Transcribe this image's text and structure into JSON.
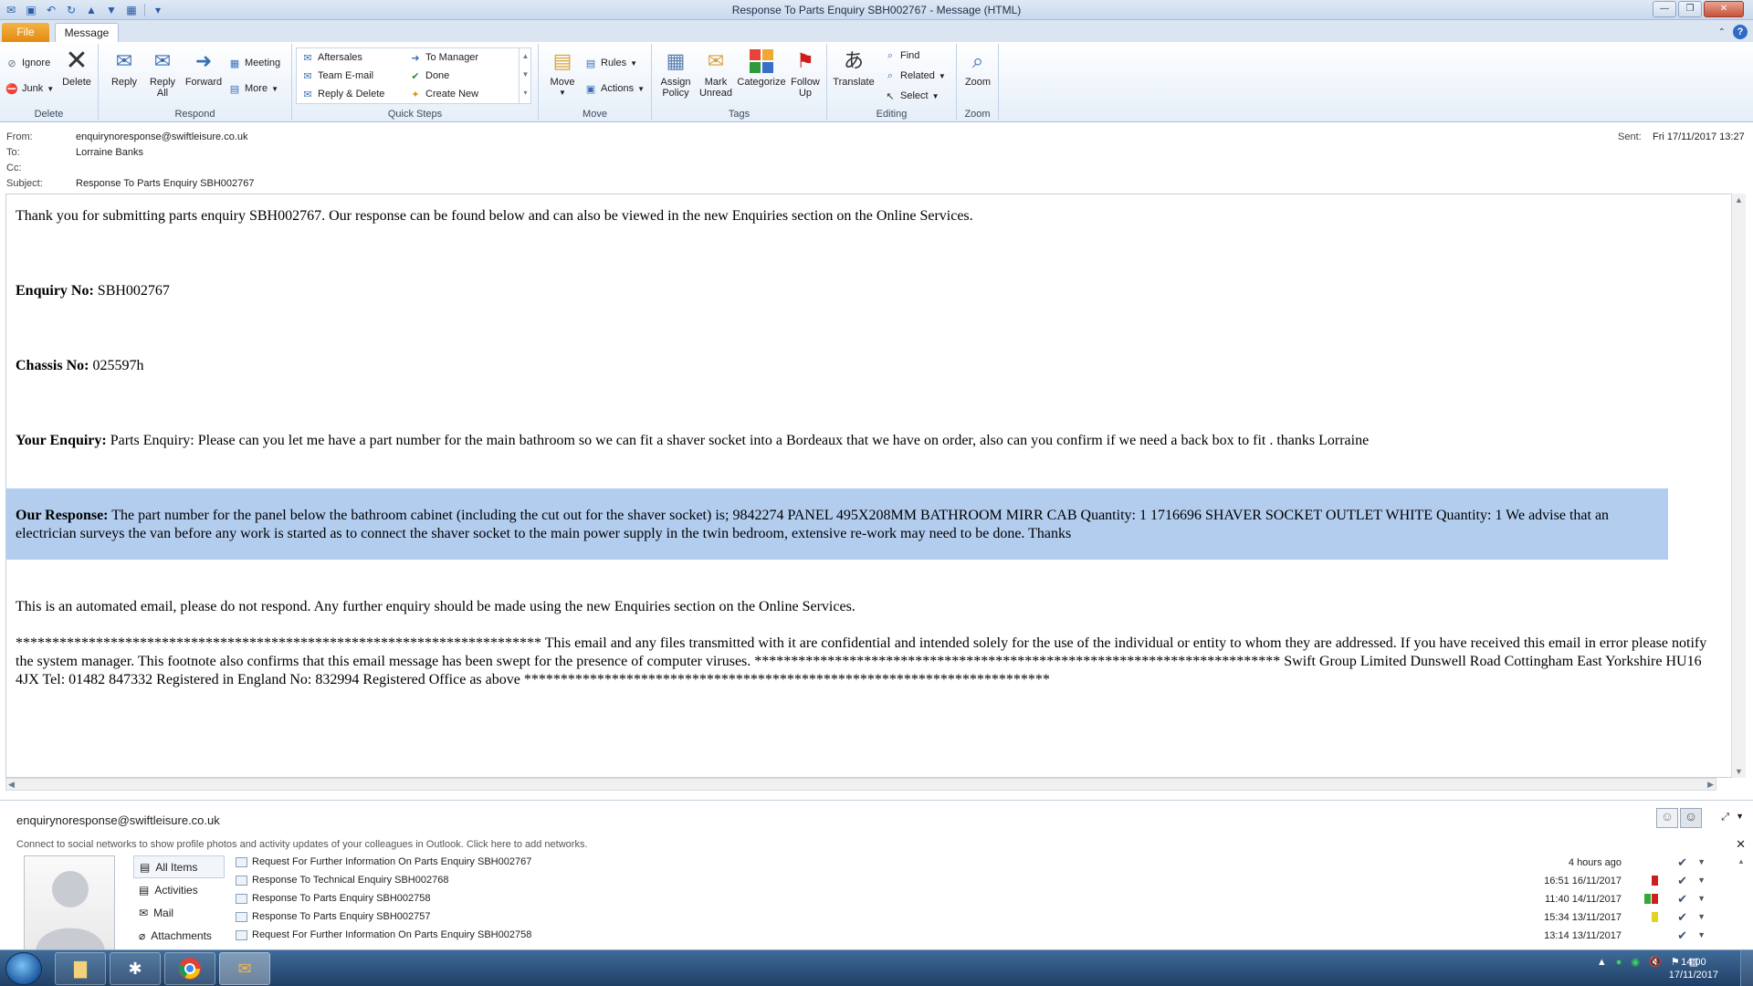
{
  "window": {
    "title": "Response To Parts Enquiry SBH002767  -  Message (HTML)"
  },
  "tabs": {
    "file": "File",
    "message": "Message"
  },
  "ribbon": {
    "delete_group": {
      "label": "Delete",
      "ignore": "Ignore",
      "junk": "Junk",
      "delete": "Delete"
    },
    "respond_group": {
      "label": "Respond",
      "reply": "Reply",
      "reply_all_1": "Reply",
      "reply_all_2": "All",
      "forward": "Forward",
      "meeting": "Meeting",
      "more": "More"
    },
    "quicksteps_group": {
      "label": "Quick Steps",
      "items": [
        "Aftersales",
        "To Manager",
        "Team E-mail",
        "Done",
        "Reply & Delete",
        "Create New"
      ]
    },
    "move_group": {
      "label": "Move",
      "move": "Move",
      "rules": "Rules",
      "actions": "Actions"
    },
    "tags_group": {
      "label": "Tags",
      "assign_1": "Assign",
      "assign_2": "Policy",
      "mark_1": "Mark",
      "mark_2": "Unread",
      "categorize": "Categorize",
      "follow_1": "Follow",
      "follow_2": "Up"
    },
    "editing_group": {
      "label": "Editing",
      "translate": "Translate",
      "find": "Find",
      "related": "Related",
      "select": "Select"
    },
    "zoom_group": {
      "label": "Zoom",
      "zoom": "Zoom"
    }
  },
  "header": {
    "from_label": "From:",
    "from": "enquirynoresponse@swiftleisure.co.uk",
    "to_label": "To:",
    "to": "Lorraine Banks",
    "cc_label": "Cc:",
    "cc": "",
    "subject_label": "Subject:",
    "subject": "Response To Parts Enquiry SBH002767",
    "sent_label": "Sent:",
    "sent": "Fri 17/11/2017 13:27"
  },
  "body": {
    "intro": "Thank you for submitting parts enquiry SBH002767. Our response can be found below and can also be viewed in the new Enquiries section on the Online Services.",
    "enquiry_label": "Enquiry No:",
    "enquiry_no": " SBH002767",
    "chassis_label": "Chassis No:",
    "chassis_no": " 025597h",
    "your_enquiry_label": "Your Enquiry:",
    "your_enquiry": " Parts Enquiry: Please can you let me have a part number for the main bathroom so we can fit a shaver socket into a Bordeaux that we have on order, also can you confirm if we need a back box to fit . thanks Lorraine",
    "response_label": "Our Response:",
    "response": " The part number for the panel below the bathroom cabinet (including the cut out for the shaver socket) is; 9842274 PANEL 495X208MM BATHROOM MIRR CAB Quantity: 1 1716696 SHAVER SOCKET OUTLET WHITE Quantity: 1 We advise that an electrician surveys the van before any work is started as to connect the shaver socket to the main power supply in the twin bedroom, extensive re-work may need to be done. Thanks",
    "automated": "This is an automated email, please do not respond. Any further enquiry should be made using the new Enquiries section on the Online Services.",
    "footer": "************************************************************************ This email and any files transmitted with it are confidential and intended solely for the use of the individual or entity to whom they are addressed. If you have received this email in error please notify the system manager. This footnote also confirms that this email message has been swept for the presence of computer viruses. ************************************************************************ Swift Group Limited Dunswell Road Cottingham East Yorkshire HU16 4JX Tel: 01482 847332 Registered in England No: 832994 Registered Office as above ************************************************************************"
  },
  "people_pane": {
    "email": "enquirynoresponse@swiftleisure.co.uk",
    "social_text": "Connect to social networks to show profile photos and activity updates of your colleagues in Outlook. Click here to add networks.",
    "nav": [
      "All Items",
      "Activities",
      "Mail",
      "Attachments"
    ],
    "items": [
      {
        "subject": "Request For Further Information On Parts Enquiry SBH002767",
        "date": "4 hours ago",
        "cat": []
      },
      {
        "subject": "Response To Technical Enquiry SBH002768",
        "date": "16:51  16/11/2017",
        "cat": [
          "#cc1f1f"
        ]
      },
      {
        "subject": "Response To Parts Enquiry SBH002758",
        "date": "11:40  14/11/2017",
        "cat": [
          "#35a83a",
          "#cc1f1f"
        ]
      },
      {
        "subject": "Response To Parts Enquiry SBH002757",
        "date": "15:34  13/11/2017",
        "cat": [
          "#e3d21f"
        ]
      },
      {
        "subject": "Request For Further Information On Parts Enquiry SBH002758",
        "date": "13:14  13/11/2017",
        "cat": []
      }
    ]
  },
  "taskbar": {
    "time": "14:00",
    "date": "17/11/2017"
  },
  "colors": {
    "highlight": "#b3cdef",
    "file_tab": "#e28a10",
    "accent": "#2d6bc4"
  }
}
